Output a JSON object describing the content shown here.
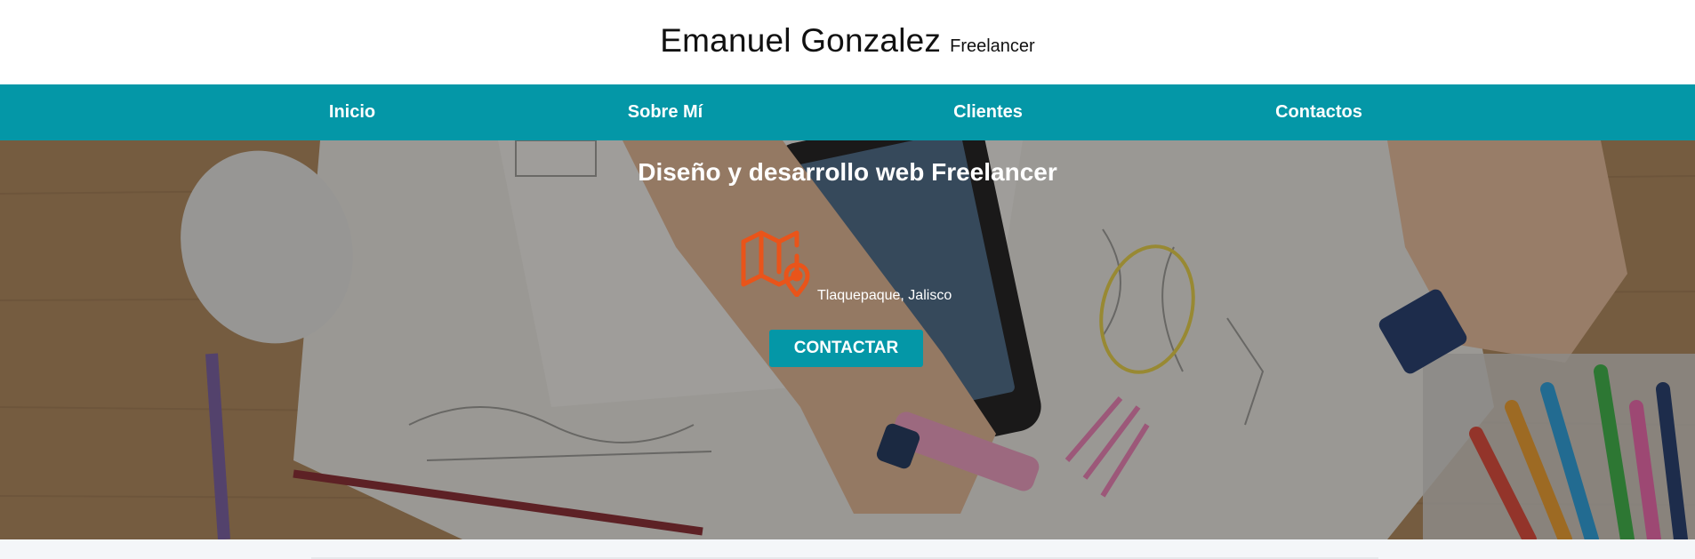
{
  "header": {
    "name": "Emanuel Gonzalez",
    "subtitle": "Freelancer"
  },
  "nav": {
    "items": [
      {
        "label": "Inicio"
      },
      {
        "label": "Sobre Mí"
      },
      {
        "label": "Clientes"
      },
      {
        "label": "Contactos"
      }
    ]
  },
  "hero": {
    "title": "Diseño y desarrollo web Freelancer",
    "location": "Tlaquepaque, Jalisco",
    "cta_label": "CONTACTAR",
    "icon": "map-location-icon",
    "background": "desk-workspace-photo"
  },
  "colors": {
    "accent": "#0497a7",
    "icon": "#e9541a",
    "text_on_dark": "#ffffff"
  }
}
